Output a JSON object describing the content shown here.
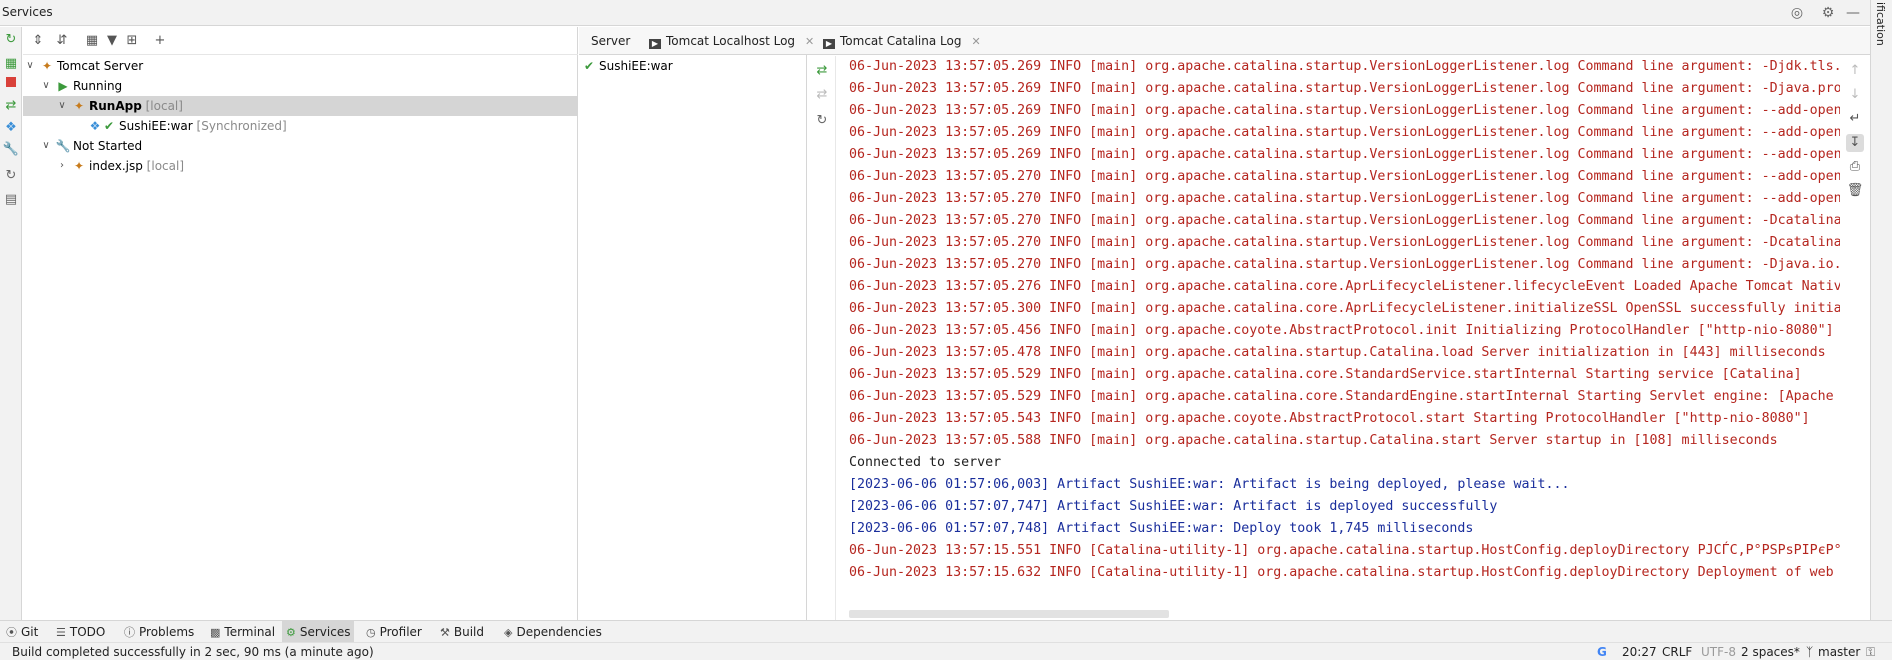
{
  "window": {
    "title": "Services",
    "right_strip_label": "ifications"
  },
  "tree": {
    "nodes": [
      {
        "label": "Tomcat Server",
        "suffix": ""
      },
      {
        "label": "Running",
        "suffix": ""
      },
      {
        "label": "RunApp",
        "suffix": " [local]"
      },
      {
        "label": "SushiEE:war",
        "suffix": " [Synchronized]"
      },
      {
        "label": "Not Started",
        "suffix": ""
      },
      {
        "label": "index.jsp",
        "suffix": " [local]"
      }
    ]
  },
  "middle": {
    "artifact": "SushiEE:war"
  },
  "tabs": [
    {
      "label": "Server"
    },
    {
      "label": "Tomcat Localhost Log"
    },
    {
      "label": "Tomcat Catalina Log"
    }
  ],
  "console": {
    "lines": [
      {
        "text": "06-Jun-2023 13:57:05.269 INFO [main] org.apache.catalina.startup.VersionLoggerListener.log Command line argument: -Djdk.tls.",
        "kind": "red"
      },
      {
        "text": "06-Jun-2023 13:57:05.269 INFO [main] org.apache.catalina.startup.VersionLoggerListener.log Command line argument: -Djava.pro",
        "kind": "red"
      },
      {
        "text": "06-Jun-2023 13:57:05.269 INFO [main] org.apache.catalina.startup.VersionLoggerListener.log Command line argument: --add-open",
        "kind": "red"
      },
      {
        "text": "06-Jun-2023 13:57:05.269 INFO [main] org.apache.catalina.startup.VersionLoggerListener.log Command line argument: --add-open",
        "kind": "red"
      },
      {
        "text": "06-Jun-2023 13:57:05.269 INFO [main] org.apache.catalina.startup.VersionLoggerListener.log Command line argument: --add-open",
        "kind": "red"
      },
      {
        "text": "06-Jun-2023 13:57:05.270 INFO [main] org.apache.catalina.startup.VersionLoggerListener.log Command line argument: --add-open",
        "kind": "red"
      },
      {
        "text": "06-Jun-2023 13:57:05.270 INFO [main] org.apache.catalina.startup.VersionLoggerListener.log Command line argument: --add-open",
        "kind": "red"
      },
      {
        "text": "06-Jun-2023 13:57:05.270 INFO [main] org.apache.catalina.startup.VersionLoggerListener.log Command line argument: -Dcatalina",
        "kind": "red"
      },
      {
        "text": "06-Jun-2023 13:57:05.270 INFO [main] org.apache.catalina.startup.VersionLoggerListener.log Command line argument: -Dcatalina",
        "kind": "red"
      },
      {
        "text": "06-Jun-2023 13:57:05.270 INFO [main] org.apache.catalina.startup.VersionLoggerListener.log Command line argument: -Djava.io.",
        "kind": "red"
      },
      {
        "text": "06-Jun-2023 13:57:05.276 INFO [main] org.apache.catalina.core.AprLifecycleListener.lifecycleEvent Loaded Apache Tomcat Nativ",
        "kind": "red"
      },
      {
        "text": "06-Jun-2023 13:57:05.300 INFO [main] org.apache.catalina.core.AprLifecycleListener.initializeSSL OpenSSL successfully initia",
        "kind": "red"
      },
      {
        "text": "06-Jun-2023 13:57:05.456 INFO [main] org.apache.coyote.AbstractProtocol.init Initializing ProtocolHandler [\"http-nio-8080\"]",
        "kind": "red"
      },
      {
        "text": "06-Jun-2023 13:57:05.478 INFO [main] org.apache.catalina.startup.Catalina.load Server initialization in [443] milliseconds",
        "kind": "red"
      },
      {
        "text": "06-Jun-2023 13:57:05.529 INFO [main] org.apache.catalina.core.StandardService.startInternal Starting service [Catalina]",
        "kind": "red"
      },
      {
        "text": "06-Jun-2023 13:57:05.529 INFO [main] org.apache.catalina.core.StandardEngine.startInternal Starting Servlet engine: [Apache",
        "kind": "red"
      },
      {
        "text": "06-Jun-2023 13:57:05.543 INFO [main] org.apache.coyote.AbstractProtocol.start Starting ProtocolHandler [\"http-nio-8080\"]",
        "kind": "red"
      },
      {
        "text": "06-Jun-2023 13:57:05.588 INFO [main] org.apache.catalina.startup.Catalina.start Server startup in [108] milliseconds",
        "kind": "red"
      },
      {
        "text": "Connected to server",
        "kind": "black"
      },
      {
        "text": "[2023-06-06 01:57:06,003] Artifact SushiEE:war: Artifact is being deployed, please wait...",
        "kind": "blue"
      },
      {
        "text": "[2023-06-06 01:57:07,747] Artifact SushiEE:war: Artifact is deployed successfully",
        "kind": "blue"
      },
      {
        "text": "[2023-06-06 01:57:07,748] Artifact SushiEE:war: Deploy took 1,745 milliseconds",
        "kind": "blue"
      },
      {
        "text": "06-Jun-2023 13:57:15.551 INFO [Catalina-utility-1] org.apache.catalina.startup.HostConfig.deployDirectory PJCЃС,Р°РЅРѕРІРєР°",
        "kind": "red"
      },
      {
        "text": "06-Jun-2023 13:57:15.632 INFO [Catalina-utility-1] org.apache.catalina.startup.HostConfig.deployDirectory Deployment of web",
        "kind": "red"
      }
    ]
  },
  "bottom_tabs": [
    {
      "label": "Git",
      "icon": "git-icon"
    },
    {
      "label": "TODO",
      "icon": "todo-icon"
    },
    {
      "label": "Problems",
      "icon": "problems-icon"
    },
    {
      "label": "Terminal",
      "icon": "terminal-icon"
    },
    {
      "label": "Services",
      "icon": "services-icon",
      "active": true
    },
    {
      "label": "Profiler",
      "icon": "profiler-icon"
    },
    {
      "label": "Build",
      "icon": "build-icon"
    },
    {
      "label": "Dependencies",
      "icon": "dependencies-icon"
    }
  ],
  "status": {
    "message": "Build completed successfully in 2 sec, 90 ms (a minute ago)",
    "position": "20:27",
    "line_separator": "CRLF",
    "encoding": "UTF-8",
    "indent": "2 spaces*",
    "branch": "master"
  },
  "colors": {
    "log_red": "#b5261f",
    "log_blue": "#1a2e9c",
    "run_green": "#3c9a3c",
    "stop_red": "#d9413a"
  }
}
